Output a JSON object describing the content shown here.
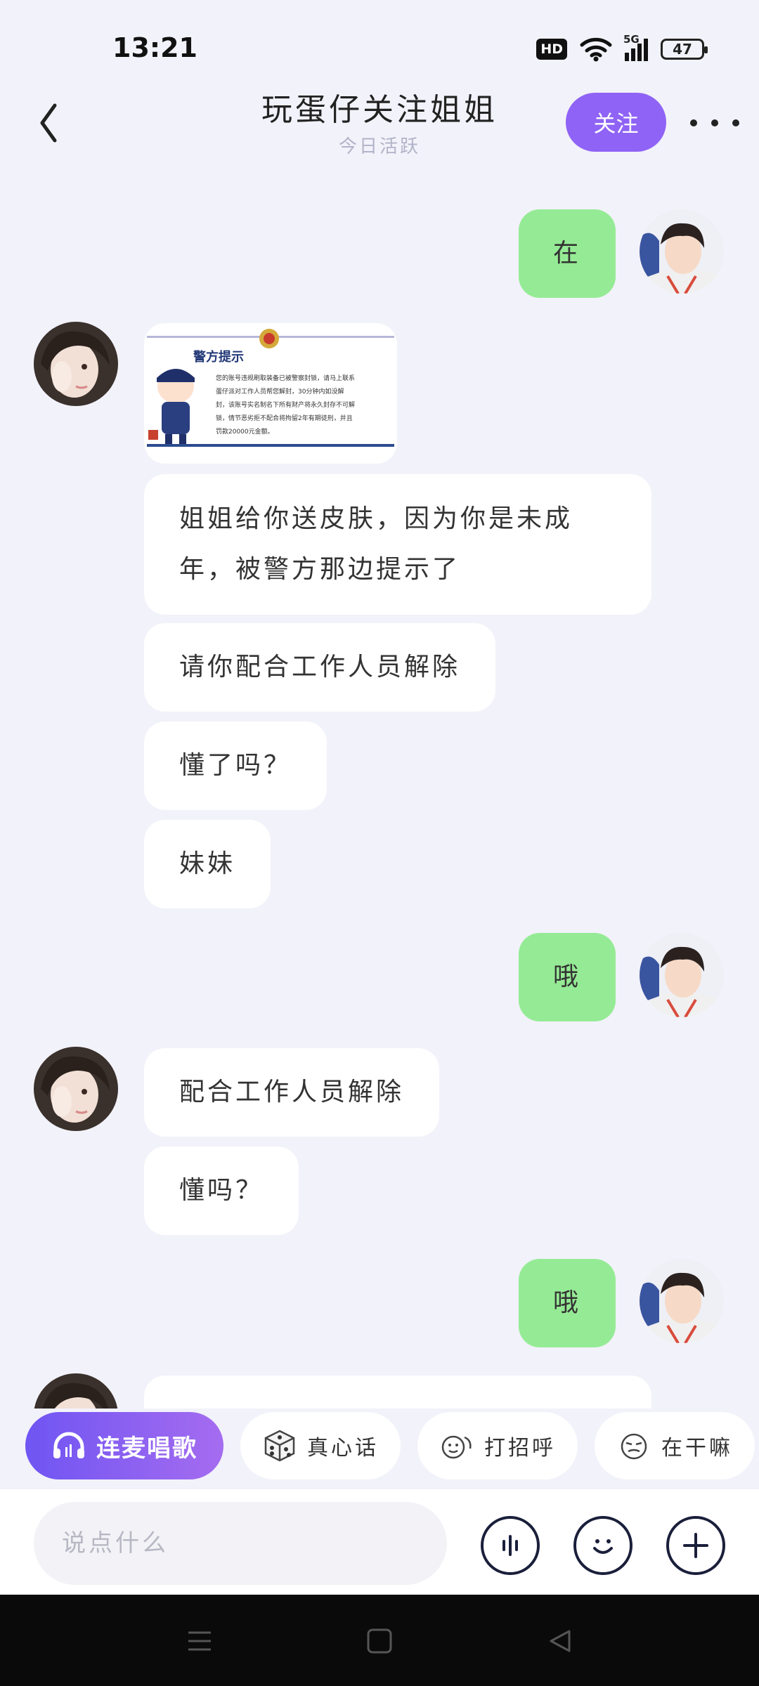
{
  "status": {
    "time": "13:21",
    "hd": "HD",
    "network": "5G",
    "battery": "47"
  },
  "header": {
    "title": "玩蛋仔关注姐姐",
    "subtitle": "今日活跃",
    "follow_label": "关注"
  },
  "image_card": {
    "heading": "警方提示",
    "lines": [
      "您的账号违规刷取装备已被警察封锁，请马上联系",
      "蛋仔派对工作人员帮您解封，30分钟内如没解",
      "封，该账号实名制名下所有财产将永久封存不可解",
      "锁，情节恶劣拒不配合将拘留2年有期徒刑，并且",
      "罚款20000元金额。"
    ]
  },
  "messages": [
    {
      "side": "out",
      "text": "在"
    },
    {
      "side": "in",
      "text": "姐姐给你送皮肤，因为你是未成年，被警方那边提示了"
    },
    {
      "side": "in",
      "text": "请你配合工作人员解除"
    },
    {
      "side": "in",
      "text": "懂了吗？"
    },
    {
      "side": "in",
      "text": "妹妹"
    },
    {
      "side": "out",
      "text": "哦"
    },
    {
      "side": "in",
      "text": "配合工作人员解除"
    },
    {
      "side": "in",
      "text": "懂吗？"
    },
    {
      "side": "out",
      "text": "哦"
    }
  ],
  "quick_actions": [
    "连麦唱歌",
    "真心话",
    "打招呼",
    "在干嘛"
  ],
  "input": {
    "placeholder": "说点什么"
  },
  "colors": {
    "accent": "#8f63f5",
    "outgoing_bubble": "#95eb95",
    "background": "#f2f2fa"
  }
}
